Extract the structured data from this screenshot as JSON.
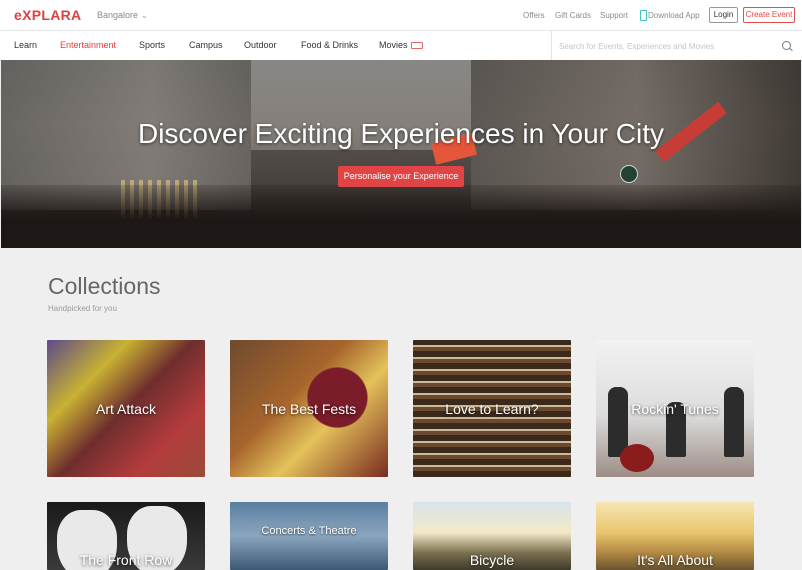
{
  "brand": {
    "logo": "eXPLARA"
  },
  "header": {
    "city": "Bangalore",
    "links": [
      "Offers",
      "Gift Cards",
      "Support",
      "Download App"
    ],
    "login_label": "Login",
    "create_label": "Create Event"
  },
  "nav": {
    "items": [
      "Learn",
      "Entertainment",
      "Sports",
      "Campus",
      "Outdoor",
      "Food & Drinks",
      "Movies"
    ],
    "active": "Entertainment",
    "search_placeholder": "Search for Events, Experiences and Movies"
  },
  "hero": {
    "headline": "Discover Exciting Experiences in Your City",
    "cta_label": "Personalise your Experience"
  },
  "collections": {
    "title": "Collections",
    "subtitle": "Handpicked for you",
    "row1": [
      "Art Attack",
      "The Best Fests",
      "Love to Learn?",
      "Rockin' Tunes"
    ],
    "row2": [
      "The Front Row",
      "Concerts & Theatre",
      "Bicycle",
      "It's All About"
    ]
  },
  "colors": {
    "accent": "#e04040",
    "background": "#efefef"
  }
}
